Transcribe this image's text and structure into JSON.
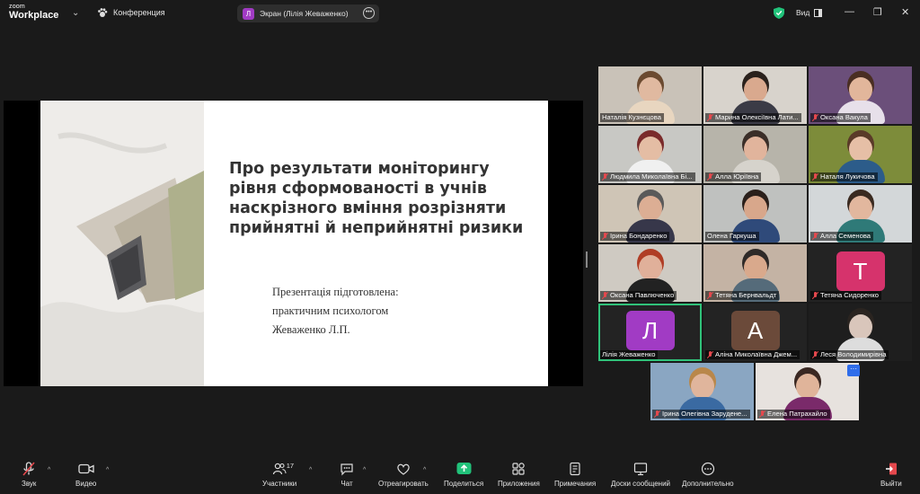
{
  "app": {
    "brand_top": "zoom",
    "brand_bottom": "Workplace"
  },
  "meeting": {
    "title": "Конференция"
  },
  "screen_share": {
    "initial": "Л",
    "label": "Экран (Лілія Жеваженко)"
  },
  "view": {
    "label": "Вид"
  },
  "slide": {
    "title": "Про результати моніторингу рівня сформованості в учнів наскрізного вміння розрізняти прийнятні й неприйнятні ризики",
    "sub1": "Презентація підготовлена:",
    "sub2": "практичним психологом",
    "sub3": "Жеваженко Л.П."
  },
  "participants": [
    {
      "name": "Наталія Кузнєцова",
      "muted": false,
      "bg": "#c9c2b8",
      "skin": "#e0b9a0",
      "hair": "#6b4a30",
      "shirt": "#e8d6c0"
    },
    {
      "name": "Марина Олексіївна Лати...",
      "muted": true,
      "bg": "#d8d3cc",
      "skin": "#d9a98e",
      "hair": "#2a211c",
      "shirt": "#3b3b46"
    },
    {
      "name": "Оксана Вакула",
      "muted": true,
      "bg": "#6b4f7a",
      "skin": "#e2b69b",
      "hair": "#4a2e22",
      "shirt": "#e7e0ea"
    },
    {
      "name": "Людмила Миколаївна Бі...",
      "muted": true,
      "bg": "#c8c8c4",
      "skin": "#e4bda4",
      "hair": "#7a2b2b",
      "shirt": "#f0f0f0"
    },
    {
      "name": "Алла Юріївна",
      "muted": true,
      "bg": "#b7b4aa",
      "skin": "#e1b49c",
      "hair": "#3a2e28",
      "shirt": "#d6d3cc"
    },
    {
      "name": "Наталя Лукичова",
      "muted": true,
      "bg": "#7d8c3a",
      "skin": "#e6bfa6",
      "hair": "#5a3a28",
      "shirt": "#2c5c8a"
    },
    {
      "name": "Ірина Бондаренко",
      "muted": true,
      "bg": "#cfc5b6",
      "skin": "#dcae94",
      "hair": "#5a5a5a",
      "shirt": "#37374a"
    },
    {
      "name": "Олена Гаркуша",
      "muted": false,
      "bg": "#bfc1bf",
      "skin": "#d8a78b",
      "hair": "#2a1f1a",
      "shirt": "#2f4a7a"
    },
    {
      "name": "Алла Семенова",
      "muted": true,
      "bg": "#d3d7d9",
      "skin": "#e2b79e",
      "hair": "#3a2a20",
      "shirt": "#2f7a78"
    },
    {
      "name": "Оксана Павлюченко",
      "muted": true,
      "bg": "#cfcac2",
      "skin": "#e0b09a",
      "hair": "#b03d25",
      "shirt": "#222222"
    },
    {
      "name": "Тетяна Бернвальдт",
      "muted": true,
      "bg": "#c4b3a4",
      "skin": "#d9a98c",
      "hair": "#2f2a28",
      "shirt": "#556b7a"
    },
    {
      "name": "Тетяна Сидоренко",
      "muted": true,
      "letter": "Т",
      "letter_bg": "#d6336c"
    },
    {
      "name": "Лілія Жеваженко",
      "muted": false,
      "letter": "Л",
      "letter_bg": "#a13bc4",
      "active": true
    },
    {
      "name": "Аліна Миколаївна Джем...",
      "muted": true,
      "letter": "А",
      "letter_bg": "#6b4a3a"
    },
    {
      "name": "Леся Володимирівна",
      "muted": true,
      "bg": "#1e1e1e",
      "skin": "#d9c6bb",
      "hair": "#2a2420",
      "shirt": "#dddddd"
    },
    {
      "name": "Ірина Олегівна Заруденe...",
      "muted": true,
      "bg": "#8aa6c2",
      "skin": "#e0b59c",
      "hair": "#b9874a",
      "shirt": "#3a6aa2"
    },
    {
      "name": "Елена Патрахайло",
      "muted": true,
      "bg": "#e7e2de",
      "skin": "#e0b49a",
      "hair": "#3a2822",
      "shirt": "#7a2a6a"
    }
  ],
  "toolbar": {
    "audio": "Звук",
    "video": "Видео",
    "participants": "Участники",
    "participants_count": "17",
    "chat": "Чат",
    "react": "Отреагировать",
    "share": "Поделиться",
    "apps": "Приложения",
    "notes": "Примечания",
    "whiteboards": "Доски сообщений",
    "more": "Дополнительно",
    "leave": "Выйти"
  },
  "colors": {
    "accent_green": "#30c27a",
    "share_green": "#21c27a",
    "muted_red": "#e5484d",
    "leave_red": "#e5484d"
  }
}
